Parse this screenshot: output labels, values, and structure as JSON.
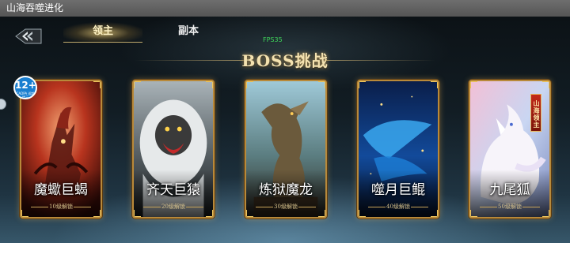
{
  "window": {
    "title": "山海吞噬进化"
  },
  "tabs": [
    {
      "label": "领主",
      "active": true
    },
    {
      "label": "副本",
      "active": false
    }
  ],
  "fps_label": "FPS35",
  "page_title": "BOSS挑战",
  "age_badge": {
    "number": "12+",
    "caption": "CADPA 适龄提示"
  },
  "cards": [
    {
      "name": "魔蠍巨蝎",
      "unlock": "10级解锁",
      "accent": "#c0392b"
    },
    {
      "name": "齐天巨猿",
      "unlock": "20级解锁",
      "accent": "#8c8c8c"
    },
    {
      "name": "炼狱魔龙",
      "unlock": "30级解锁",
      "accent": "#6e7f5a"
    },
    {
      "name": "噬月巨鲲",
      "unlock": "40级解锁",
      "accent": "#1d6fd1"
    },
    {
      "name": "九尾狐",
      "unlock": "50级解锁",
      "accent": "#e6d8f0",
      "tag": "山海领主"
    }
  ],
  "colors": {
    "frame_gold": "#b8893a",
    "title_gold": "#f4e2b0",
    "fps_green": "#3ed45a"
  }
}
